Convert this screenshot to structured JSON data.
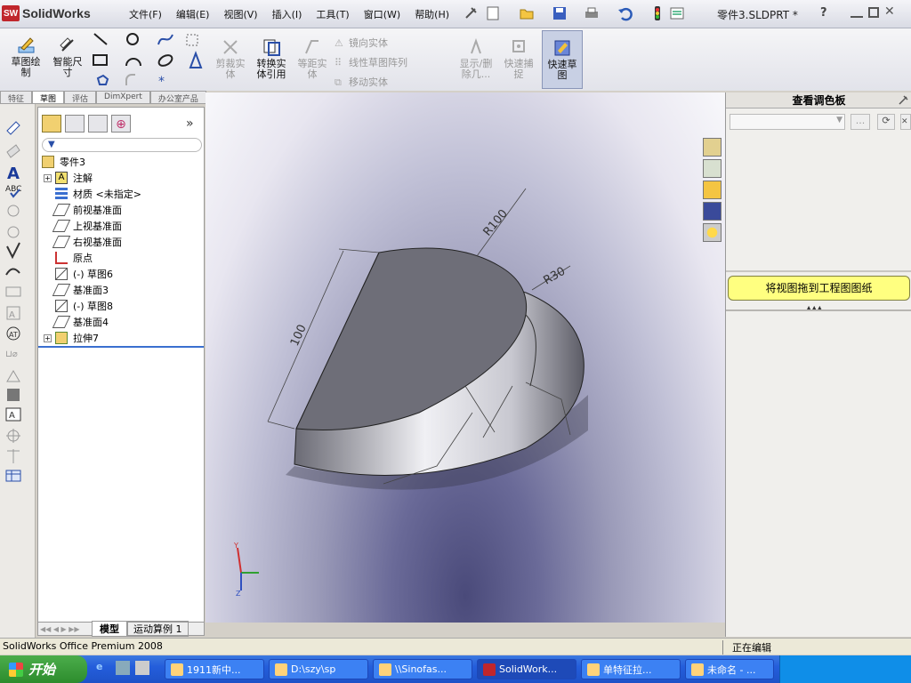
{
  "title_bar": {
    "app_name": "SolidWorks",
    "logo_badge": "SW",
    "document_title": "零件3.SLDPRT *",
    "menus": [
      "文件(F)",
      "编辑(E)",
      "视图(V)",
      "插入(I)",
      "工具(T)",
      "窗口(W)",
      "帮助(H)"
    ],
    "help_label": "?"
  },
  "command_manager": {
    "buttons": [
      {
        "label": "草图绘\n制"
      },
      {
        "label": "智能尺\n寸"
      },
      {
        "label": "剪裁实\n体"
      },
      {
        "label": "转换实\n体引用"
      },
      {
        "label": "等距实\n体"
      },
      {
        "label": "镜向实体"
      },
      {
        "label": "线性草图阵列"
      },
      {
        "label": "移动实体"
      },
      {
        "label": "显示/删\n除几..."
      },
      {
        "label": "快速捕\n捉"
      },
      {
        "label": "快速草\n图"
      }
    ]
  },
  "tabs": [
    "特征",
    "草图",
    "评估",
    "DimXpert",
    "办公室产品"
  ],
  "active_tab": "草图",
  "feature_tree": {
    "root": "零件3",
    "items": [
      {
        "label": "注解",
        "icon": "annotation-icon",
        "expandable": true
      },
      {
        "label": "材质 <未指定>",
        "icon": "material-icon",
        "expandable": false
      },
      {
        "label": "前视基准面",
        "icon": "plane-icon",
        "expandable": false
      },
      {
        "label": "上视基准面",
        "icon": "plane-icon",
        "expandable": false
      },
      {
        "label": "右视基准面",
        "icon": "plane-icon",
        "expandable": false
      },
      {
        "label": "原点",
        "icon": "origin-icon",
        "expandable": false
      },
      {
        "label": "(-) 草图6",
        "icon": "sketch-icon",
        "expandable": false
      },
      {
        "label": "基准面3",
        "icon": "plane-icon",
        "expandable": false
      },
      {
        "label": "(-) 草图8",
        "icon": "sketch-icon",
        "expandable": false
      },
      {
        "label": "基准面4",
        "icon": "plane-icon",
        "expandable": false
      },
      {
        "label": "拉伸7",
        "icon": "extrude-icon",
        "expandable": true
      }
    ],
    "bottom_tabs": [
      "模型",
      "运动算例 1"
    ]
  },
  "viewport": {
    "dimensions": [
      "R100",
      "R30",
      "100"
    ]
  },
  "task_pane": {
    "title": "查看调色板",
    "drag_hint": "将视图拖到工程图图纸",
    "browse_label": "..."
  },
  "status_bar": {
    "left": "SolidWorks Office Premium 2008",
    "right": "正在编辑"
  },
  "taskbar": {
    "start": "开始",
    "tasks": [
      "1911新中...",
      "D:\\szy\\sp",
      "\\\\Sinofas...",
      "SolidWork...",
      "单特征拉...",
      "未命名 - ..."
    ]
  },
  "colors": {
    "accent_yellow": "#ffff80",
    "taskbar_blue": "#245edb",
    "start_green": "#3a9a3a"
  }
}
